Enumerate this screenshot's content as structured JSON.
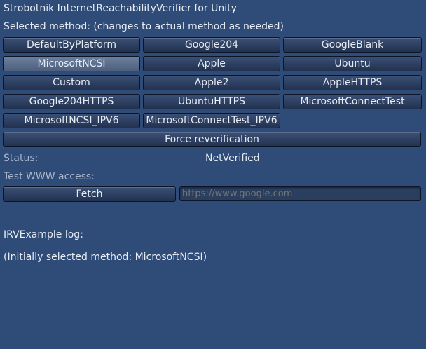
{
  "header": {
    "title": "Strobotnik InternetReachabilityVerifier for Unity",
    "selected_method_label": "Selected method: (changes to actual method as needed)"
  },
  "methods": [
    {
      "label": "DefaultByPlatform",
      "selected": false
    },
    {
      "label": "Google204",
      "selected": false
    },
    {
      "label": "GoogleBlank",
      "selected": false
    },
    {
      "label": "MicrosoftNCSI",
      "selected": true
    },
    {
      "label": "Apple",
      "selected": false
    },
    {
      "label": "Ubuntu",
      "selected": false
    },
    {
      "label": "Custom",
      "selected": false
    },
    {
      "label": "Apple2",
      "selected": false
    },
    {
      "label": "AppleHTTPS",
      "selected": false
    },
    {
      "label": "Google204HTTPS",
      "selected": false
    },
    {
      "label": "UbuntuHTTPS",
      "selected": false
    },
    {
      "label": "MicrosoftConnectTest",
      "selected": false
    },
    {
      "label": "MicrosoftNCSI_IPV6",
      "selected": false
    },
    {
      "label": "MicrosoftConnectTest_IPV6",
      "selected": false
    }
  ],
  "force_reverification_label": "Force reverification",
  "status": {
    "label": "Status:",
    "value": "NetVerified"
  },
  "test_www": {
    "label": "Test WWW access:",
    "fetch_label": "Fetch",
    "url_placeholder": "https://www.google.com"
  },
  "log": {
    "title": "IRVExample log:",
    "entries": [
      "(Initially selected method: MicrosoftNCSI)"
    ]
  }
}
